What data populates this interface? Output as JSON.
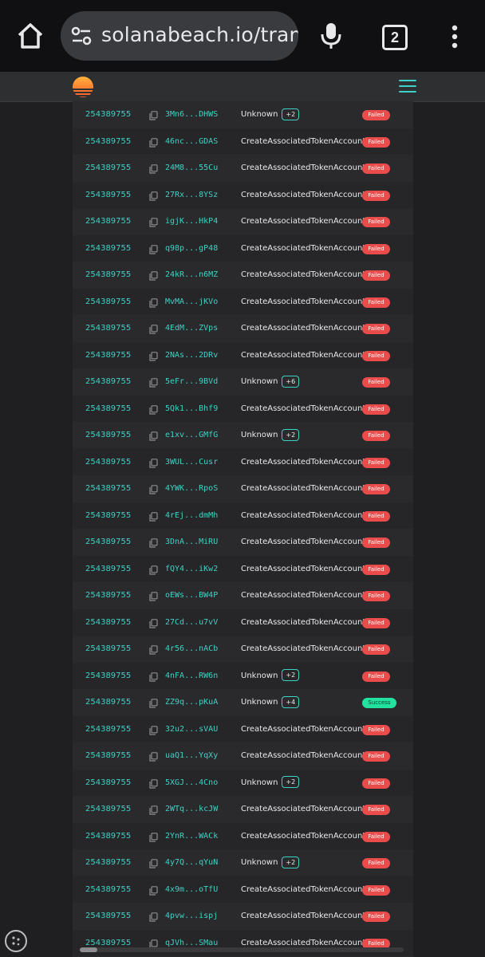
{
  "browser": {
    "url": "solanabeach.io/trans",
    "tab_count": "2"
  },
  "transactions": [
    {
      "block": "254389755",
      "signature": "3Mn6...DHWS",
      "instruction": "Unknown",
      "more": "+2",
      "status": "Failed"
    },
    {
      "block": "254389755",
      "signature": "46nc...GDAS",
      "instruction": "CreateAssociatedTokenAccount",
      "more": "",
      "status": "Failed"
    },
    {
      "block": "254389755",
      "signature": "24M8...55Cu",
      "instruction": "CreateAssociatedTokenAccount",
      "more": "",
      "status": "Failed"
    },
    {
      "block": "254389755",
      "signature": "27Rx...8YSz",
      "instruction": "CreateAssociatedTokenAccount",
      "more": "",
      "status": "Failed"
    },
    {
      "block": "254389755",
      "signature": "igjK...HkP4",
      "instruction": "CreateAssociatedTokenAccount",
      "more": "",
      "status": "Failed"
    },
    {
      "block": "254389755",
      "signature": "q98p...gP48",
      "instruction": "CreateAssociatedTokenAccount",
      "more": "",
      "status": "Failed"
    },
    {
      "block": "254389755",
      "signature": "24kR...n6MZ",
      "instruction": "CreateAssociatedTokenAccount",
      "more": "",
      "status": "Failed"
    },
    {
      "block": "254389755",
      "signature": "MvMA...jKVo",
      "instruction": "CreateAssociatedTokenAccount",
      "more": "",
      "status": "Failed"
    },
    {
      "block": "254389755",
      "signature": "4EdM...ZVps",
      "instruction": "CreateAssociatedTokenAccount",
      "more": "",
      "status": "Failed"
    },
    {
      "block": "254389755",
      "signature": "2NAs...2DRv",
      "instruction": "CreateAssociatedTokenAccount",
      "more": "",
      "status": "Failed"
    },
    {
      "block": "254389755",
      "signature": "5eFr...9BVd",
      "instruction": "Unknown",
      "more": "+6",
      "status": "Failed"
    },
    {
      "block": "254389755",
      "signature": "5Qk1...Bhf9",
      "instruction": "CreateAssociatedTokenAccount",
      "more": "",
      "status": "Failed"
    },
    {
      "block": "254389755",
      "signature": "e1xv...GMfG",
      "instruction": "Unknown",
      "more": "+2",
      "status": "Failed"
    },
    {
      "block": "254389755",
      "signature": "3WUL...Cusr",
      "instruction": "CreateAssociatedTokenAccount",
      "more": "",
      "status": "Failed"
    },
    {
      "block": "254389755",
      "signature": "4YWK...RpoS",
      "instruction": "CreateAssociatedTokenAccount",
      "more": "",
      "status": "Failed"
    },
    {
      "block": "254389755",
      "signature": "4rEj...dmMh",
      "instruction": "CreateAssociatedTokenAccount",
      "more": "",
      "status": "Failed"
    },
    {
      "block": "254389755",
      "signature": "3DnA...MiRU",
      "instruction": "CreateAssociatedTokenAccount",
      "more": "",
      "status": "Failed"
    },
    {
      "block": "254389755",
      "signature": "fQY4...iKw2",
      "instruction": "CreateAssociatedTokenAccount",
      "more": "",
      "status": "Failed"
    },
    {
      "block": "254389755",
      "signature": "oEWs...BW4P",
      "instruction": "CreateAssociatedTokenAccount",
      "more": "",
      "status": "Failed"
    },
    {
      "block": "254389755",
      "signature": "27Cd...u7vV",
      "instruction": "CreateAssociatedTokenAccount",
      "more": "",
      "status": "Failed"
    },
    {
      "block": "254389755",
      "signature": "4r56...nACb",
      "instruction": "CreateAssociatedTokenAccount",
      "more": "",
      "status": "Failed"
    },
    {
      "block": "254389755",
      "signature": "4nFA...RW6n",
      "instruction": "Unknown",
      "more": "+2",
      "status": "Failed"
    },
    {
      "block": "254389755",
      "signature": "ZZ9q...pKuA",
      "instruction": "Unknown",
      "more": "+4",
      "status": "Success"
    },
    {
      "block": "254389755",
      "signature": "32u2...sVAU",
      "instruction": "CreateAssociatedTokenAccount",
      "more": "",
      "status": "Failed"
    },
    {
      "block": "254389755",
      "signature": "uaQ1...YqXy",
      "instruction": "CreateAssociatedTokenAccount",
      "more": "",
      "status": "Failed"
    },
    {
      "block": "254389755",
      "signature": "5XGJ...4Cno",
      "instruction": "Unknown",
      "more": "+2",
      "status": "Failed"
    },
    {
      "block": "254389755",
      "signature": "2WTq...kcJW",
      "instruction": "CreateAssociatedTokenAccount",
      "more": "",
      "status": "Failed"
    },
    {
      "block": "254389755",
      "signature": "2YnR...WACk",
      "instruction": "CreateAssociatedTokenAccount",
      "more": "",
      "status": "Failed"
    },
    {
      "block": "254389755",
      "signature": "4y7Q...qYuN",
      "instruction": "Unknown",
      "more": "+2",
      "status": "Failed"
    },
    {
      "block": "254389755",
      "signature": "4x9m...oTfU",
      "instruction": "CreateAssociatedTokenAccount",
      "more": "",
      "status": "Failed"
    },
    {
      "block": "254389755",
      "signature": "4pvw...ispj",
      "instruction": "CreateAssociatedTokenAccount",
      "more": "",
      "status": "Failed"
    },
    {
      "block": "254389755",
      "signature": "qJVh...SMau",
      "instruction": "CreateAssociatedTokenAccount",
      "more": "",
      "status": "Failed"
    }
  ],
  "colors": {
    "accent": "#3ed1c5",
    "failed": "#ea4b4b",
    "success": "#23e29f",
    "page_bg": "#1f1f21",
    "table_bg": "#2a2a2c"
  }
}
